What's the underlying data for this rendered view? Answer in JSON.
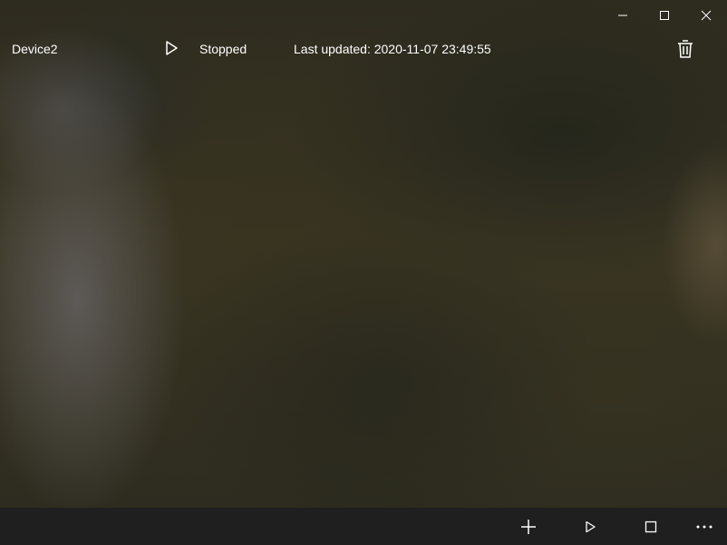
{
  "device": {
    "name": "Device2",
    "status": "Stopped",
    "last_updated": "Last updated: 2020-11-07 23:49:55"
  },
  "icons": {
    "minimize": "minimize-icon",
    "maximize": "maximize-icon",
    "close": "close-icon",
    "play": "play-icon",
    "delete": "trash-icon",
    "add": "plus-icon",
    "stop": "stop-icon",
    "more": "more-icon"
  },
  "colors": {
    "command_bar": "#1f1f1f",
    "text": "#ffffff"
  }
}
